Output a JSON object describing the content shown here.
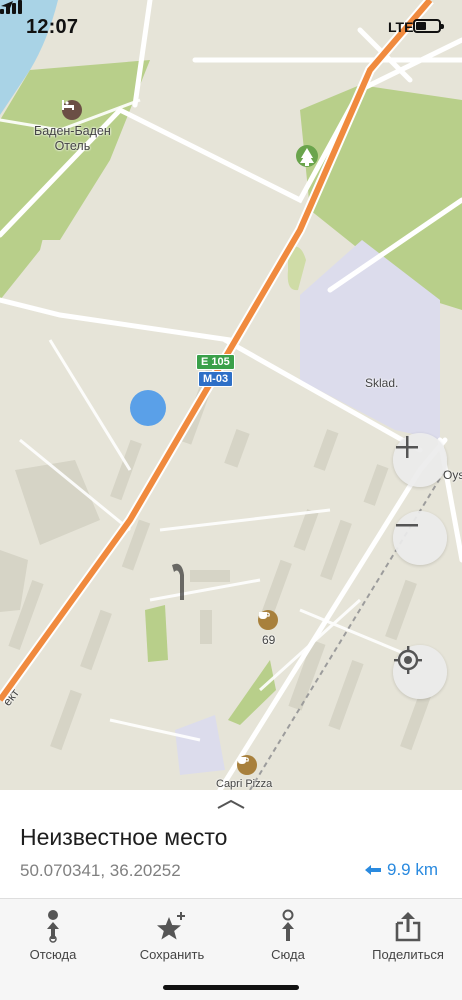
{
  "status_bar": {
    "time": "12:07",
    "network": "LTE"
  },
  "map": {
    "labels": {
      "hotel": "Баден-Баден\nОтель",
      "warehouse": "Sklad.",
      "cafe_number": "69",
      "pizza": "Capri Pizza",
      "edge_right": "Oys",
      "edge_left": "ект"
    },
    "shields": {
      "e_route": "E 105",
      "m_route": "M-03"
    },
    "colors": {
      "highway": "#f08a3e",
      "park": "#b8cf8a",
      "water": "#a9d3e6",
      "industrial": "#dcdcec",
      "pin": "#5aa0e8"
    }
  },
  "map_controls": {
    "zoom_in": "plus-icon",
    "zoom_out": "minus-icon",
    "locate": "locate-icon"
  },
  "place": {
    "title": "Неизвестное место",
    "coords": "50.070341, 36.20252",
    "distance": "9.9 km"
  },
  "toolbar": {
    "from": "Отсюда",
    "save": "Сохранить",
    "to": "Сюда",
    "share": "Поделиться"
  }
}
